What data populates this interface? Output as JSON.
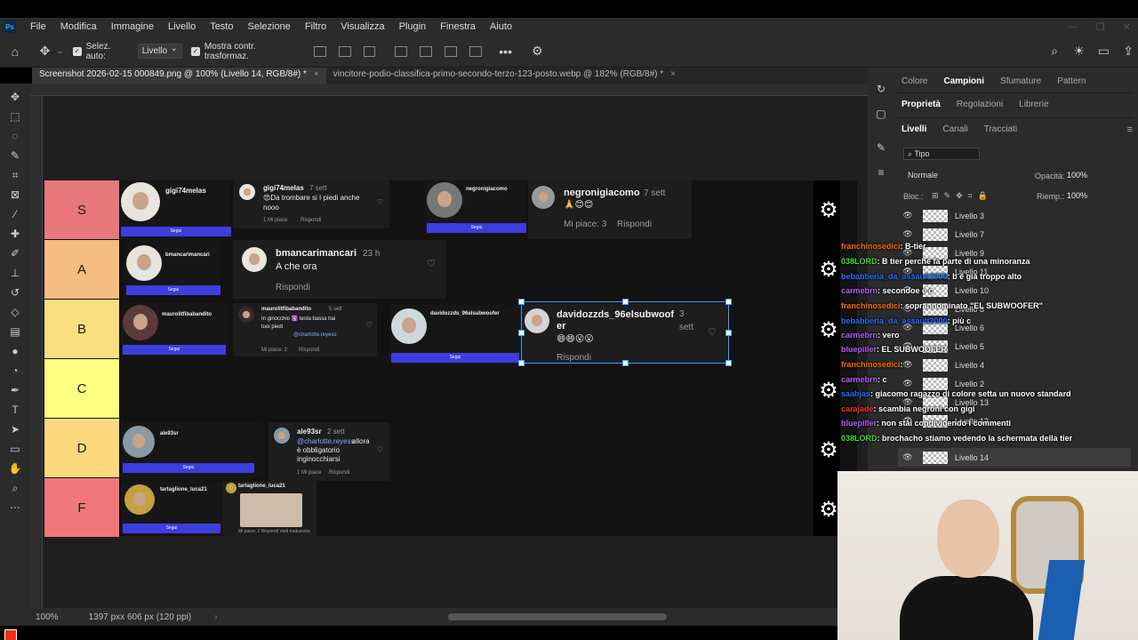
{
  "app": {
    "logo": "Ps",
    "menu": [
      "File",
      "Modifica",
      "Immagine",
      "Livello",
      "Testo",
      "Selezione",
      "Filtro",
      "Visualizza",
      "Plugin",
      "Finestra",
      "Aiuto"
    ]
  },
  "options_bar": {
    "auto_select_label": "Selez. auto:",
    "auto_select_value": "Livello",
    "show_transform_label": "Mostra contr. trasformaz."
  },
  "tabs": [
    {
      "label": "Screenshot 2026-02-15 000849.png @ 100% (Livello 14, RGB/8#) *",
      "close": "×"
    },
    {
      "label": "vincitore-podio-classifica-primo-secondo-terzo-123-posto.webp @ 182% (RGB/8#) *",
      "close": "×"
    }
  ],
  "status": {
    "zoom": "100%",
    "doc_info": "1397 pxx 606 px (120 ppi)"
  },
  "tiers": [
    {
      "label": "S",
      "color": "#e8787c"
    },
    {
      "label": "A",
      "color": "#f6bd80"
    },
    {
      "label": "B",
      "color": "#f9de7f"
    },
    {
      "label": "C",
      "color": "#fcff7f"
    },
    {
      "label": "D",
      "color": "#fcd97f"
    },
    {
      "label": "F",
      "color": "#f0787c"
    }
  ],
  "cards": {
    "s_profile": {
      "name": "gigi74melas",
      "follow": "Segui"
    },
    "s_comment": {
      "name": "gigi74melas",
      "time": "7 sett",
      "text1": "😍Da trombare si I piedi anche",
      "text2": "nooo",
      "likes": "1 Mi piace",
      "reply": "Rispondi"
    },
    "s_profile2": {
      "name": "negronigiacomo",
      "follow": "Segui"
    },
    "s_comment2": {
      "name": "negronigiacomo",
      "time": "7 sett",
      "emoji": "🙏😊😊",
      "likes": "Mi piace: 3",
      "reply": "Rispondi"
    },
    "a_profile": {
      "name": "bmancarimancari",
      "follow": "Segui"
    },
    "a_comment": {
      "name": "bmancarimancari",
      "time": "23 h",
      "text": "A che ora",
      "reply": "Rispondi"
    },
    "b_profile": {
      "name": "maurolitfibabandito",
      "follow": "Segui"
    },
    "b_comment": {
      "name": "maurolitfibabandito",
      "time": "5 sett",
      "text1": "In ginocchio 🛐 testa bassa hai",
      "text2": "tuoi piedi",
      "mention": "@charlotte.reyess",
      "likes": "Mi piace: 2",
      "reply": "Rispondi"
    },
    "b_profile2": {
      "name": "davidozzds_96elsubwoofer",
      "follow": "Segui"
    },
    "b_comment2": {
      "name": "davidozzds_96elsubwoof",
      "name2": "er",
      "time": "3",
      "time2": "sett",
      "emoji": "😄😄😮😮",
      "reply": "Rispondi"
    },
    "d_profile": {
      "name": "ale93sr",
      "follow": "Segui"
    },
    "d_comment": {
      "name": "ale93sr",
      "time": "2 sett",
      "mention": "@charlotte.reyess",
      "text1": "allora",
      "text2": "è obbligatorio",
      "text3": "inginocchiarsi",
      "likes": "1 Mi piace",
      "reply": "Rispondi"
    },
    "f_profile": {
      "name": "tartaglione_luca21",
      "follow": "Segui"
    },
    "f_comment": {
      "name": "tartaglione_luca21",
      "footer": "Mi piace: 2   Rispondi   Vedi traduzione"
    }
  },
  "panels": {
    "top_tabs": [
      "Colore",
      "Campioni",
      "Sfumature",
      "Pattern"
    ],
    "mid_tabs": [
      "Proprietà",
      "Regolazioni",
      "Librerie"
    ],
    "layer_tabs": [
      "Livelli",
      "Canali",
      "Tracciati"
    ],
    "kind_filter": "Tipo",
    "blend_mode": "Normale",
    "opacity_label": "Opacità:",
    "opacity_value": "100%",
    "lock_label": "Bloc.:",
    "fill_label": "Riemp.:",
    "fill_value": "100%"
  },
  "layers": [
    "Livello 3",
    "Livello 7",
    "Livello 9",
    "Livello 11",
    "Livello 10",
    "Livello 8",
    "Livello 6",
    "Livello 5",
    "Livello 4",
    "Livello 2",
    "Livello 13",
    "Livello 12",
    "Livello 14"
  ],
  "chat": [
    {
      "user": "franchinosedici",
      "msg": ": B-tier",
      "color": "#ff6a00"
    },
    {
      "user": "038LORD",
      "msg": ": B tier perchè fa parte di una minoranza",
      "color": "#3fe03f"
    },
    {
      "user": "bebabberia_da_assault2000",
      "msg": ": b è già troppo alto",
      "color": "#1e6fff"
    },
    {
      "user": "carmebrn",
      "msg": ": secondoe è c",
      "color": "#b45cff"
    },
    {
      "user": "franchinosedici",
      "msg": ": soprannominato \"EL SUBWOOFER\"",
      "color": "#ff6a00"
    },
    {
      "user": "bebabberia_da_assault2000",
      "msg": ": più c",
      "color": "#1e6fff"
    },
    {
      "user": "carmebrn",
      "msg": ": vero",
      "color": "#b45cff"
    },
    {
      "user": "bluepiller",
      "msg": ": EL SUBWOOFER",
      "color": "#b45cff"
    },
    {
      "user": "franchinosedici",
      "msg": ":",
      "color": "#ff6a00"
    },
    {
      "user": "carmebrn",
      "msg": ": c",
      "color": "#b45cff"
    },
    {
      "user": "saabjas",
      "msg": ": giacomo ragazzo di colore setta un nuovo standard",
      "color": "#1e6fff"
    },
    {
      "user": "carajade",
      "msg": ": scambia negroni con gigi",
      "color": "#ff3030"
    },
    {
      "user": "bluepiller",
      "msg": ": non stai condividendo i commenti",
      "color": "#b45cff"
    },
    {
      "user": "038LORD",
      "msg": ": brochacho stiamo vedendo la schermata della tier",
      "color": "#3fe03f"
    }
  ]
}
